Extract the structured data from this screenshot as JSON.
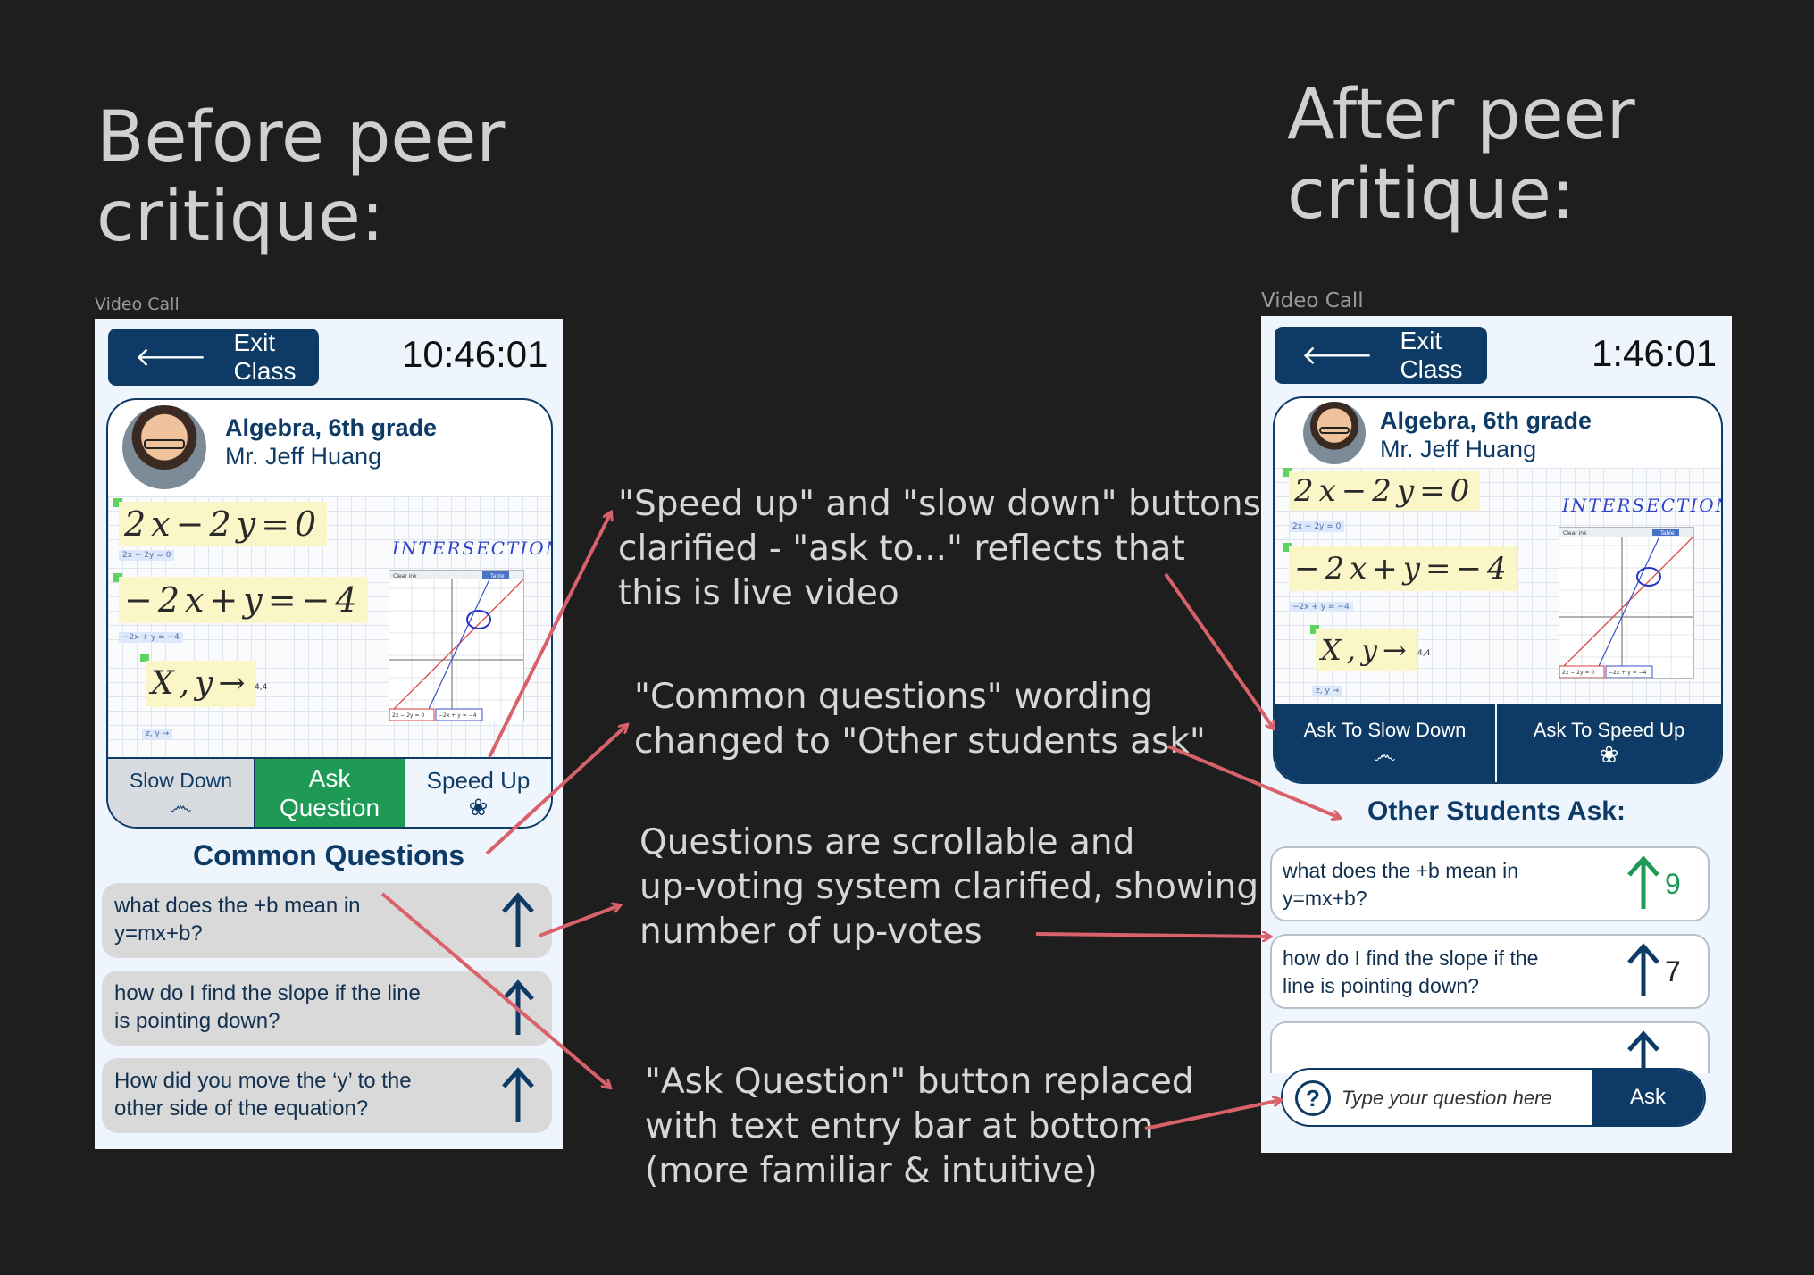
{
  "headings": {
    "before": "Before peer\ncritique:",
    "after": "After peer\ncritique:"
  },
  "frame_label": "Video Call",
  "before": {
    "exit_label": "Exit Class",
    "time": "10:46:01",
    "course": "Algebra, 6th grade",
    "teacher": "Mr. Jeff Huang",
    "controls": {
      "slow": "Slow Down",
      "ask": "Ask\nQuestion",
      "speed": "Speed Up"
    },
    "section_title": "Common Questions",
    "questions": [
      "what does the +b mean in\ny=mx+b?",
      "how do I find the slope if the line\nis pointing down?",
      "How did you move the ‘y’ to the\nother side of the equation?"
    ]
  },
  "after": {
    "exit_label": "Exit Class",
    "time": "1:46:01",
    "course": "Algebra, 6th grade",
    "teacher": "Mr. Jeff Huang",
    "controls": {
      "slow": "Ask To Slow Down",
      "speed": "Ask To Speed Up"
    },
    "section_title": "Other Students Ask:",
    "questions": [
      {
        "text": "what does the +b mean in\ny=mx+b?",
        "votes": "9"
      },
      {
        "text": "how do I find the slope if the\nline is pointing down?",
        "votes": "7"
      }
    ],
    "ask_placeholder": "Type your question here",
    "ask_button": "Ask"
  },
  "whiteboard": {
    "eq1": "2x−2y=0",
    "eq2": "−2x+y=−4",
    "eq3": "X,y→",
    "eq1_small": "2x − 2y = 0",
    "eq2_small": "−2x + y = −4",
    "eq3_small": "z, y →",
    "eq3_value": "4,4",
    "intersection": "INTERSECTION",
    "graph_clear": "Clear ink",
    "graph_table": "Table",
    "graph_eq1": "2x − 2y = 0",
    "graph_eq2": "−2x + y = −4"
  },
  "notes": [
    "\"Speed up\" and \"slow down\" buttons\nclarified - \"ask to...\" reflects that\nthis is live video",
    "\"Common questions\" wording\nchanged to \"Other students ask\"",
    "Questions are scrollable and\nup-voting system clarified, showing\nnumber of up-votes",
    "\"Ask Question\" button replaced\nwith text entry bar at bottom\n(more familiar & intuitive)"
  ],
  "colors": {
    "background": "#1e1e1e",
    "navy": "#0d3b66",
    "green_accent": "#1e9a55",
    "annotation_arrow": "#d9626a",
    "question_card": "#d9d9d9"
  },
  "icons": [
    "back-arrow-icon",
    "snail-icon",
    "rabbit-icon",
    "upvote-arrow-icon",
    "question-mark-icon"
  ]
}
